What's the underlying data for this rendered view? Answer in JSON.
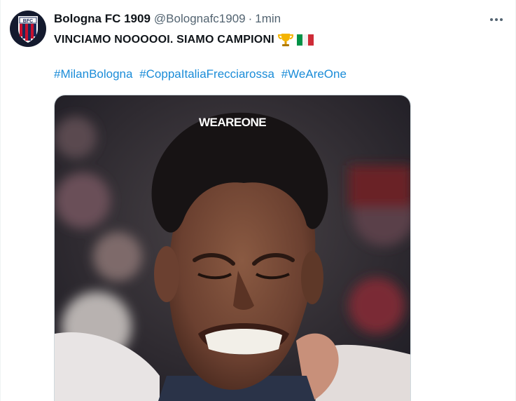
{
  "tweet": {
    "author": {
      "display_name": "Bologna FC 1909",
      "handle": "@Bolognafc1909",
      "separator": "·",
      "timestamp": "1min",
      "avatar_text": "BFC"
    },
    "text": "VINCIAMO NOOOOOI. SIAMO CAMPIONI",
    "emojis": [
      "trophy-icon",
      "italy-flag-icon"
    ],
    "hashtags": [
      "#MilanBologna",
      "#CoppaItaliaFrecciarossa",
      "#WeAreOne"
    ],
    "media": {
      "overlay_text": "WEAREONE"
    }
  },
  "colors": {
    "text_primary": "#0f1419",
    "text_secondary": "#536471",
    "link": "#1a8cd8",
    "avatar_bg": "#141a2e",
    "crest_red": "#c8102e",
    "crest_blue": "#1b2a5a"
  }
}
